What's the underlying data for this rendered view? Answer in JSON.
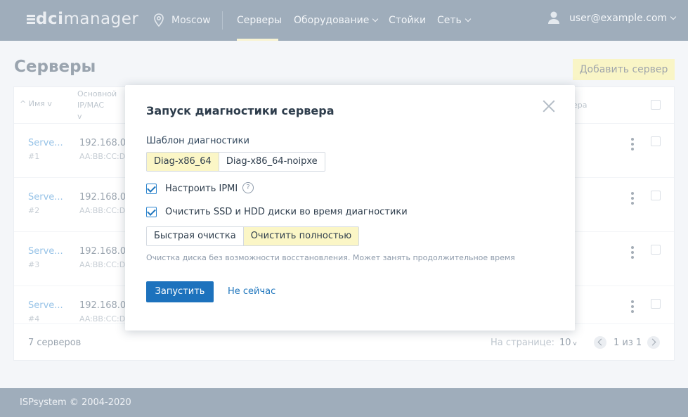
{
  "header": {
    "logo_prefix": "dci",
    "logo_suffix": "manager",
    "location": "Moscow",
    "nav": [
      {
        "label": "Серверы",
        "active": true,
        "dropdown": false
      },
      {
        "label": "Оборудование",
        "active": false,
        "dropdown": true
      },
      {
        "label": "Стойки",
        "active": false,
        "dropdown": false
      },
      {
        "label": "Сеть",
        "active": false,
        "dropdown": true
      }
    ],
    "user": "user@example.com"
  },
  "page": {
    "title": "Серверы",
    "add_button": "Добавить сервер",
    "table": {
      "columns": {
        "name": "Имя",
        "main_ip": "Основной IP/MAC",
        "tail": "ера"
      },
      "rows": [
        {
          "name": "Serve...",
          "id": "#1",
          "ip": "192.168.0.",
          "mac": "AA:BB:CC:D"
        },
        {
          "name": "Serve...",
          "id": "#2",
          "ip": "192.168.0.",
          "mac": "AA:BB:CC:D"
        },
        {
          "name": "Serve...",
          "id": "#3",
          "ip": "192.168.0.",
          "mac": "AA:BB:CC:D"
        },
        {
          "name": "Serve...",
          "id": "#4",
          "ip": "192.168.0.",
          "mac": "AA:BB:CC:D"
        }
      ]
    },
    "footer": {
      "count": "7 серверов",
      "per_page_label": "На странице:",
      "per_page_value": "10",
      "page_info": "1 из 1"
    }
  },
  "site_footer": "ISPsystem © 2004-2020",
  "modal": {
    "title": "Запуск диагностики сервера",
    "template_label": "Шаблон диагностики",
    "templates": [
      {
        "label": "Diag-x86_64",
        "active": true
      },
      {
        "label": "Diag-x86_64-noipxe",
        "active": false
      }
    ],
    "ipmi_label": "Настроить IPMI",
    "ipmi_checked": true,
    "wipe_label": "Очистить SSD и HDD диски во время диагностики",
    "wipe_checked": true,
    "wipe_modes": [
      {
        "label": "Быстрая очистка",
        "active": false
      },
      {
        "label": "Очистить полностью",
        "active": true
      }
    ],
    "hint": "Очистка диска без возможности восстановления. Может занять продолжительное время",
    "run_button": "Запустить",
    "later_link": "Не сейчас"
  },
  "colors": {
    "header_bg": "#3f5b77",
    "accent": "#1d72bd",
    "highlight": "#fbf6c6",
    "add_button_bg": "#f3eb8c"
  },
  "icons": [
    "map-pin-icon",
    "user-icon",
    "chevron-down-icon",
    "close-icon",
    "help-icon",
    "checkmark-icon",
    "kebab-menu-icon",
    "chevron-left-icon",
    "chevron-right-icon",
    "sort-arrow-icon"
  ]
}
